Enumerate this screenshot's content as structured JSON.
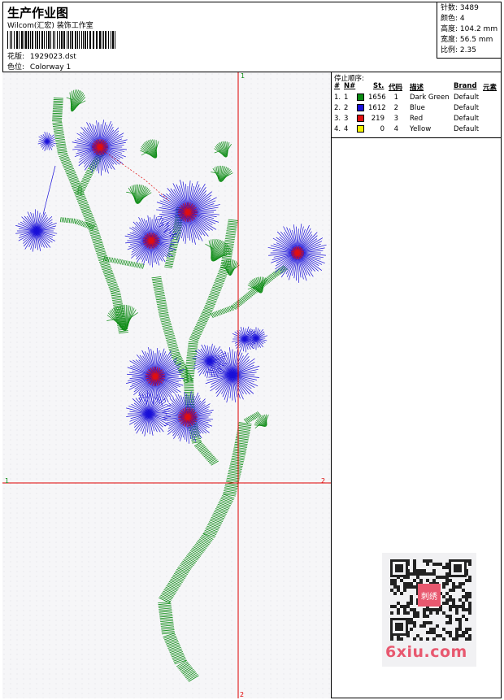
{
  "header": {
    "title": "生产作业图",
    "company": "Wilcom(汇宏) 装饰工作室",
    "design_label": "花版:",
    "design_value": "1929023.dst",
    "color_label": "色位:",
    "color_value": "Colorway 1"
  },
  "stats": [
    {
      "label": "针数:",
      "value": "3489"
    },
    {
      "label": "颜色:",
      "value": "4"
    },
    {
      "label": "高度:",
      "value": "104.2 mm"
    },
    {
      "label": "宽度:",
      "value": "56.5 mm"
    },
    {
      "label": "比例:",
      "value": "2.35"
    }
  ],
  "stop_table": {
    "title": "停止顺序:",
    "headers": [
      "#",
      "N#",
      "St.",
      "代码",
      "描述",
      "Brand",
      "元素"
    ],
    "rows": [
      {
        "num": "1.",
        "n": "1",
        "color": "#0a8a12",
        "st": "1656",
        "code": "1",
        "desc": "Dark Green",
        "brand": "Default"
      },
      {
        "num": "2.",
        "n": "2",
        "color": "#1a10d8",
        "st": "1612",
        "code": "2",
        "desc": "Blue",
        "brand": "Default"
      },
      {
        "num": "3.",
        "n": "3",
        "color": "#e01010",
        "st": "219",
        "code": "3",
        "desc": "Red",
        "brand": "Default"
      },
      {
        "num": "4.",
        "n": "4",
        "color": "#f2f000",
        "st": "0",
        "code": "4",
        "desc": "Yellow",
        "brand": "Default"
      }
    ]
  },
  "axis_labels": {
    "top": "1",
    "left": "1",
    "right": "2",
    "bottom": "2"
  },
  "watermark": {
    "text": "6xiu.com",
    "stamp": "刺绣"
  },
  "colors": {
    "green": "#0a8a12",
    "blue": "#1a10d8",
    "red": "#e01010",
    "axis": "#e00000"
  }
}
